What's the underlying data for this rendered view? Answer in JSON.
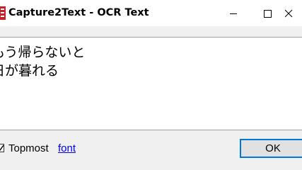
{
  "window": {
    "title": "Capture2Text - OCR Text",
    "controls": [
      "minimize-icon",
      "maximize-icon",
      "close-icon"
    ]
  },
  "ocr": {
    "text": "もう帰らないと\n日が暮れる"
  },
  "options": {
    "topmost_label": "Topmost",
    "topmost_checked": true,
    "font_link": "font"
  },
  "buttons": {
    "ok_label": "OK"
  },
  "colors": {
    "accent": "#0078d7",
    "link": "#0000ee",
    "icon_red": "#c8202a"
  }
}
